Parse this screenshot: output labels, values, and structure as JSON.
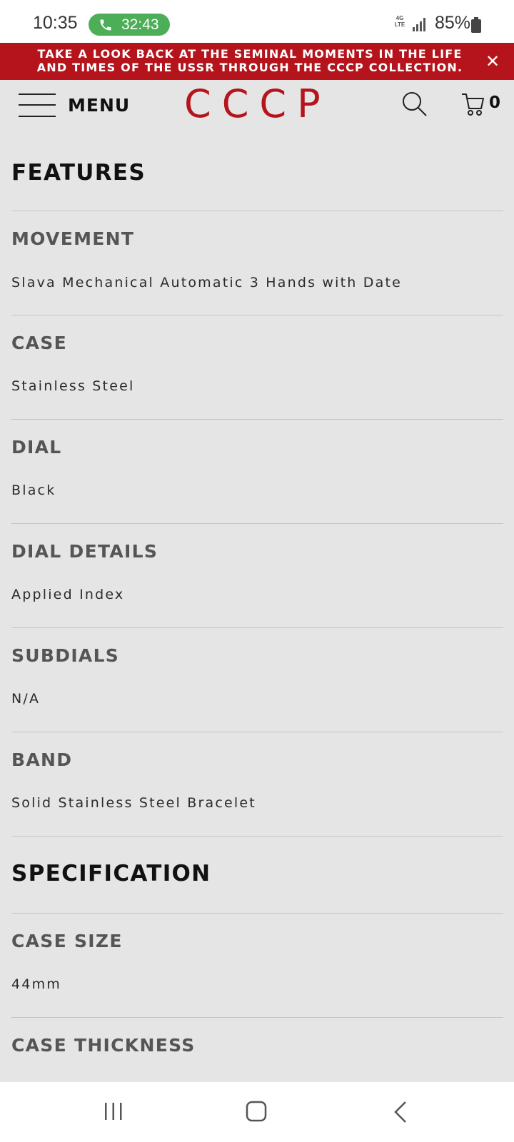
{
  "status_bar": {
    "time": "10:35",
    "call_timer": "32:43",
    "network_top": "4G",
    "network_bottom": "LTE",
    "battery": "85%"
  },
  "promo": {
    "line1": "TAKE A LOOK BACK AT THE SEMINAL MOMENTS IN THE LIFE",
    "line2": "AND TIMES OF THE USSR THROUGH THE CCCP COLLECTION.",
    "close_label": "✕"
  },
  "header": {
    "menu_label": "MENU",
    "brand": "CCCP",
    "cart_count": "0"
  },
  "features": {
    "title": "FEATURES",
    "items": [
      {
        "label": "MOVEMENT",
        "value": "Slava Mechanical Automatic 3 Hands with Date"
      },
      {
        "label": "CASE",
        "value": "Stainless Steel"
      },
      {
        "label": "DIAL",
        "value": "Black"
      },
      {
        "label": "DIAL DETAILS",
        "value": "Applied Index"
      },
      {
        "label": "SUBDIALS",
        "value": "N/A"
      },
      {
        "label": "BAND",
        "value": "Solid Stainless Steel Bracelet"
      }
    ]
  },
  "specification": {
    "title": "SPECIFICATION",
    "items": [
      {
        "label": "CASE SIZE",
        "value": "44mm"
      },
      {
        "label": "CASE THICKNESS",
        "value": ""
      }
    ]
  },
  "colors": {
    "accent": "#b5141c",
    "call_green": "#4cae57",
    "background": "#e5e5e5"
  },
  "icons": [
    "phone-icon",
    "signal-icon",
    "battery-icon",
    "close-icon",
    "hamburger-icon",
    "search-icon",
    "cart-icon",
    "recent-apps-icon",
    "home-icon",
    "back-icon"
  ]
}
